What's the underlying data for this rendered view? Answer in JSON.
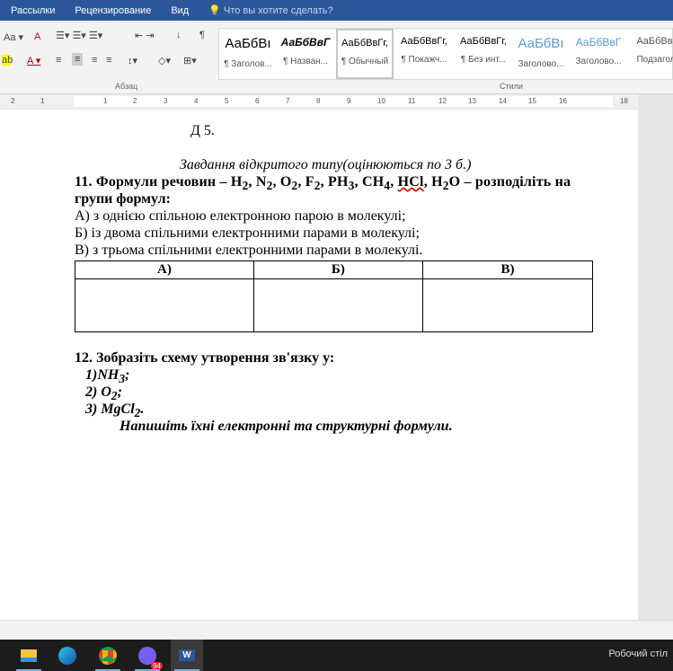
{
  "menu": {
    "items": [
      "Рассылки",
      "Рецензирование",
      "Вид"
    ],
    "tell_me": "Что вы хотите сделать?"
  },
  "ribbon": {
    "font_size_label": "Aa",
    "paragraph_group": "Абзац",
    "styles_group": "Стили",
    "styles": [
      {
        "sample": "АаБбВı",
        "label": "¶ Заголов..."
      },
      {
        "sample": "АаБбВвГ",
        "label": "¶ Назван..."
      },
      {
        "sample": "АаБбВвГг,",
        "label": "¶ Обычный"
      },
      {
        "sample": "АаБбВвГг,",
        "label": "¶ Покажч..."
      },
      {
        "sample": "АаБбВвГг,",
        "label": "¶ Без инт..."
      },
      {
        "sample": "АаБбВı",
        "label": "Заголово..."
      },
      {
        "sample": "АаБбВвГ",
        "label": "Заголово..."
      },
      {
        "sample": "АаБбВвı",
        "label": "Подзагол"
      }
    ]
  },
  "ruler": {
    "ticks": [
      "2",
      "1",
      "1",
      "2",
      "3",
      "4",
      "5",
      "6",
      "7",
      "8",
      "9",
      "10",
      "11",
      "12",
      "13",
      "14",
      "15",
      "16",
      "18"
    ]
  },
  "document": {
    "d5": "Д 5.",
    "section_heading": "Завдання відкритого типу(оцінюються по 3 б.)",
    "q11": {
      "parts": [
        [
          "11. Формули речовин – H",
          ""
        ],
        [
          "",
          "2"
        ],
        [
          ", N",
          ""
        ],
        [
          "",
          "2"
        ],
        [
          ", O",
          ""
        ],
        [
          "",
          "2"
        ],
        [
          ", F",
          ""
        ],
        [
          "",
          "2"
        ],
        [
          ", PH",
          ""
        ],
        [
          "",
          "3"
        ],
        [
          ", CH",
          ""
        ],
        [
          "",
          "4"
        ],
        [
          ", ",
          ""
        ],
        [
          "HCl",
          "sq"
        ],
        [
          ", H",
          ""
        ],
        [
          "",
          "2"
        ],
        [
          "O – розподіліть на",
          ""
        ]
      ],
      "line2": "групи формул:",
      "options": [
        "А) з однією спільною електронною парою в молекулі;",
        "Б) із двома спільними електронними парами в молекулі;",
        "В) з трьома спільними електронними парами в молекулі."
      ],
      "table_headers": [
        "А)",
        "Б)",
        "В)"
      ]
    },
    "q12": {
      "title": "12. Зобразіть схему  утворення зв'язку у:",
      "items": [
        {
          "pre": "1)NH",
          "sub": "3",
          "post": ";"
        },
        {
          "pre": "2) O",
          "sub": "2",
          "post": ";"
        },
        {
          "pre": "3) MgCl",
          "sub": "2",
          "post": "."
        }
      ],
      "instruction": "Напишіть їхні електронні та структурні формули."
    }
  },
  "taskbar": {
    "word_label": "W",
    "viber_badge": "94",
    "desktop_label": "Робочий стіл"
  }
}
